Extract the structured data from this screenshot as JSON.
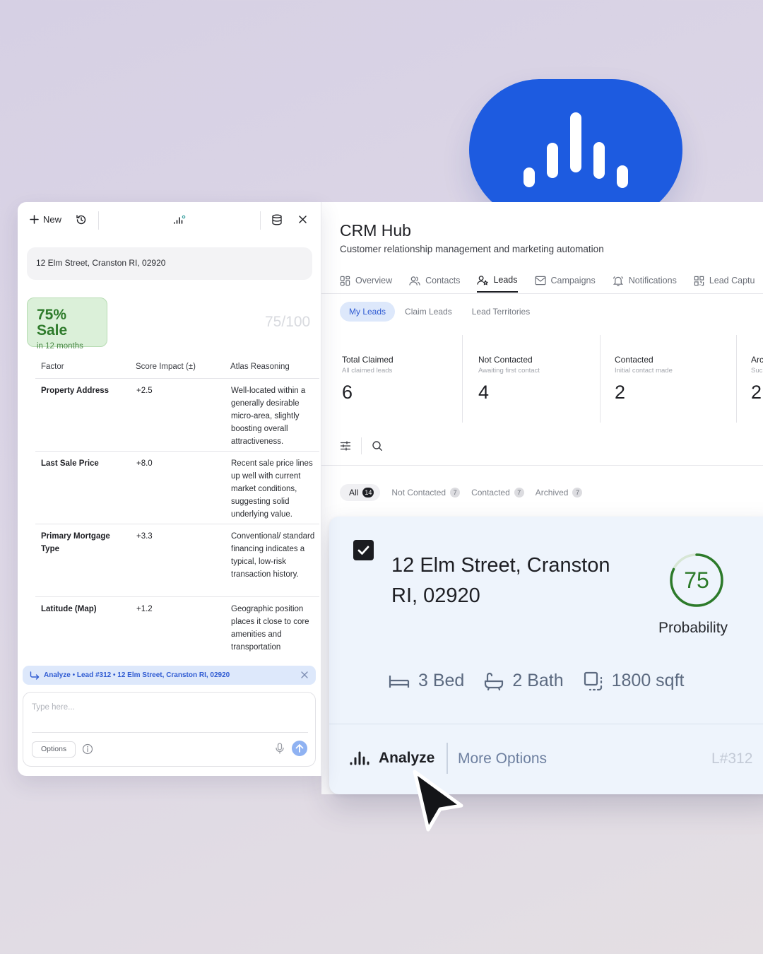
{
  "colors": {
    "brand": "#1d5be0",
    "accent": "#2f5bd2",
    "success": "#2e7b2b",
    "card_bg": "#eef4fc"
  },
  "assistant": {
    "toolbar": {
      "new_label": "New",
      "icons": [
        "plus-icon",
        "history-icon",
        "app-logo-icon",
        "database-icon",
        "close-icon"
      ]
    },
    "address": "12 Elm Street, Cranston RI, 02920",
    "sale": {
      "headline": "75% Sale",
      "sub": "in 12 months"
    },
    "score": "75/100",
    "table": {
      "headers": [
        "Factor",
        "Score Impact (±)",
        "Atlas Reasoning"
      ],
      "rows": [
        {
          "factor": "Property Address",
          "impact": "+2.5",
          "reasoning": "Well-located within a generally desirable micro-area, slightly boosting overall attractiveness."
        },
        {
          "factor": "Last Sale Price",
          "impact": "+8.0",
          "reasoning": "Recent sale price lines up well with current market conditions, suggesting solid underlying value."
        },
        {
          "factor": "Primary Mortgage Type",
          "impact": "+3.3",
          "reasoning": "Conventional/ standard financing indicates a typical, low-risk transaction history."
        },
        {
          "factor": "Latitude (Map)",
          "impact": "+1.2",
          "reasoning": "Geographic position places it close to core amenities and transportation"
        }
      ]
    },
    "context_chip": "Analyze • Lead #312 • 12 Elm Street, Cranston RI, 02920",
    "composer": {
      "placeholder": "Type here...",
      "options_label": "Options"
    }
  },
  "crm": {
    "title": "CRM Hub",
    "subtitle": "Customer relationship management and marketing automation",
    "tabs": [
      {
        "label": "Overview",
        "icon": "grid-icon"
      },
      {
        "label": "Contacts",
        "icon": "users-icon"
      },
      {
        "label": "Leads",
        "icon": "user-star-icon",
        "active": true
      },
      {
        "label": "Campaigns",
        "icon": "mail-icon"
      },
      {
        "label": "Notifications",
        "icon": "bell-icon"
      },
      {
        "label": "Lead Captu",
        "icon": "qr-icon"
      }
    ],
    "subtabs": [
      "My Leads",
      "Claim Leads",
      "Lead Territories"
    ],
    "stats": [
      {
        "label": "Total Claimed",
        "hint": "All claimed leads",
        "value": "6"
      },
      {
        "label": "Not Contacted",
        "hint": "Awaiting first contact",
        "value": "4"
      },
      {
        "label": "Contacted",
        "hint": "Initial contact made",
        "value": "2"
      },
      {
        "label": "Arc",
        "hint": "Suc",
        "value": "2"
      }
    ],
    "filters": [
      {
        "label": "All",
        "count": "14",
        "active": true
      },
      {
        "label": "Not Contacted",
        "count": "7"
      },
      {
        "label": "Contacted",
        "count": "7"
      },
      {
        "label": "Archived",
        "count": "7"
      }
    ]
  },
  "lead_card": {
    "address": "12 Elm Street, Cranston RI, 02920",
    "probability": 75,
    "probability_text": "75",
    "probability_label": "Probability",
    "beds": "3 Bed",
    "baths": "2 Bath",
    "area": "1800 sqft",
    "analyze_label": "Analyze",
    "more_label": "More Options",
    "lead_id": "L#312"
  }
}
